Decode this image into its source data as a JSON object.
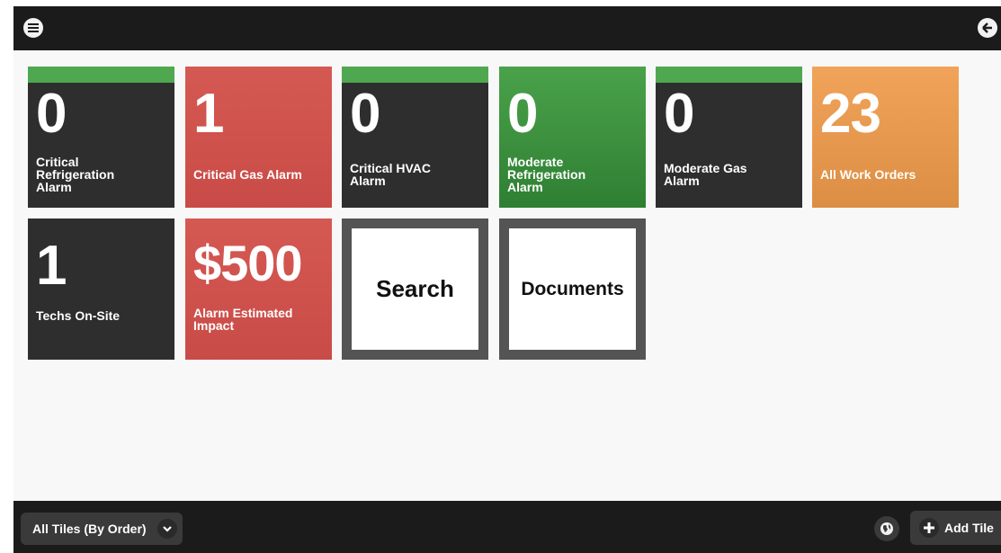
{
  "topbar": {
    "menu_icon": "hamburger-menu-icon",
    "back_icon": "back-arrow-icon"
  },
  "tiles": [
    {
      "value": "0",
      "label": [
        "Critical",
        "Refrigeration",
        "Alarm"
      ],
      "color": "#2e2e2e",
      "status_stripe": "#4fa84f"
    },
    {
      "value": "1",
      "label": [
        "Critical Gas Alarm"
      ],
      "color": "#cf524c"
    },
    {
      "value": "0",
      "label": [
        "Critical HVAC",
        "Alarm"
      ],
      "color": "#2e2e2e",
      "status_stripe": "#4fa84f"
    },
    {
      "value": "0",
      "label": [
        "Moderate",
        "Refrigeration",
        "Alarm"
      ],
      "color": "#3f933f"
    },
    {
      "value": "0",
      "label": [
        "Moderate Gas",
        "Alarm"
      ],
      "color": "#2e2e2e",
      "status_stripe": "#4fa84f"
    },
    {
      "value": "23",
      "label": [
        "All Work Orders"
      ],
      "color": "#ea9a4f"
    },
    {
      "value": "1",
      "label": [
        "Techs On-Site"
      ],
      "color": "#2e2e2e"
    },
    {
      "value": "$500",
      "label": [
        "Alarm Estimated",
        "Impact"
      ],
      "color": "#cf524c"
    }
  ],
  "link_tiles": [
    {
      "label": "Search"
    },
    {
      "label": "Documents"
    }
  ],
  "bottombar": {
    "filter_label": "All Tiles (By Order)",
    "filter_icon": "chevron-down-icon",
    "globe_icon": "globe-icon",
    "add_label": "Add Tile",
    "add_icon": "plus-icon"
  }
}
